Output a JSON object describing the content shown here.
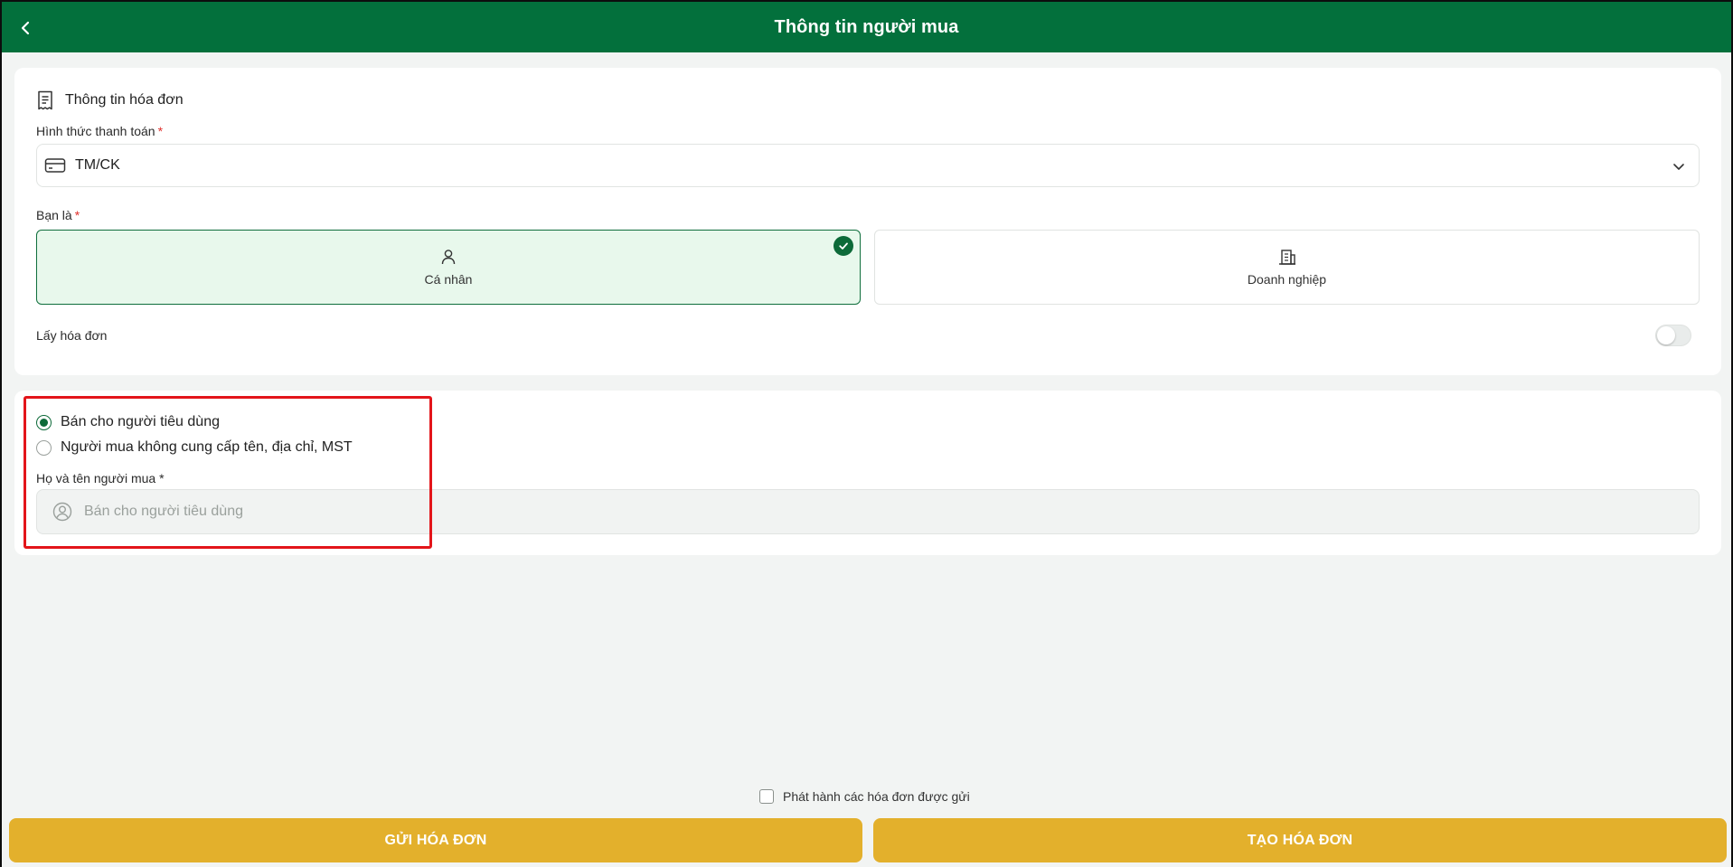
{
  "header": {
    "title": "Thông tin người mua",
    "back_icon": "chevron-left-icon"
  },
  "invoice_info": {
    "section_title": "Thông tin hóa đơn",
    "section_icon": "receipt-icon",
    "payment_method_label": "Hình thức thanh toán",
    "payment_method_required": "*",
    "payment_method_value": "TM/CK",
    "payment_icon": "credit-card-icon",
    "you_are_label": "Bạn là",
    "you_are_required": "*",
    "options": [
      {
        "label": "Cá nhân",
        "icon": "user-icon",
        "selected": true
      },
      {
        "label": "Doanh nghiệp",
        "icon": "building-icon",
        "selected": false
      }
    ],
    "get_invoice_label": "Lấy hóa đơn",
    "get_invoice_enabled": false
  },
  "buyer": {
    "radio_options": [
      {
        "label": "Bán cho người tiêu dùng",
        "selected": true
      },
      {
        "label": "Người mua không cung cấp tên, địa chỉ, MST",
        "selected": false
      }
    ],
    "name_label": "Họ và tên người mua *",
    "name_placeholder": "Bán cho người tiêu dùng",
    "name_value": ""
  },
  "footer": {
    "issue_checkbox_label": "Phát hành các hóa đơn được gửi",
    "issue_checkbox_checked": false,
    "send_button": "GỬI HÓA ĐƠN",
    "create_button": "TẠO HÓA ĐƠN"
  },
  "colors": {
    "header": "#03703c",
    "accent_green": "#0d6a39",
    "selected_bg": "#e8f8ec",
    "button": "#e3b02c",
    "highlight": "#e3151a"
  }
}
